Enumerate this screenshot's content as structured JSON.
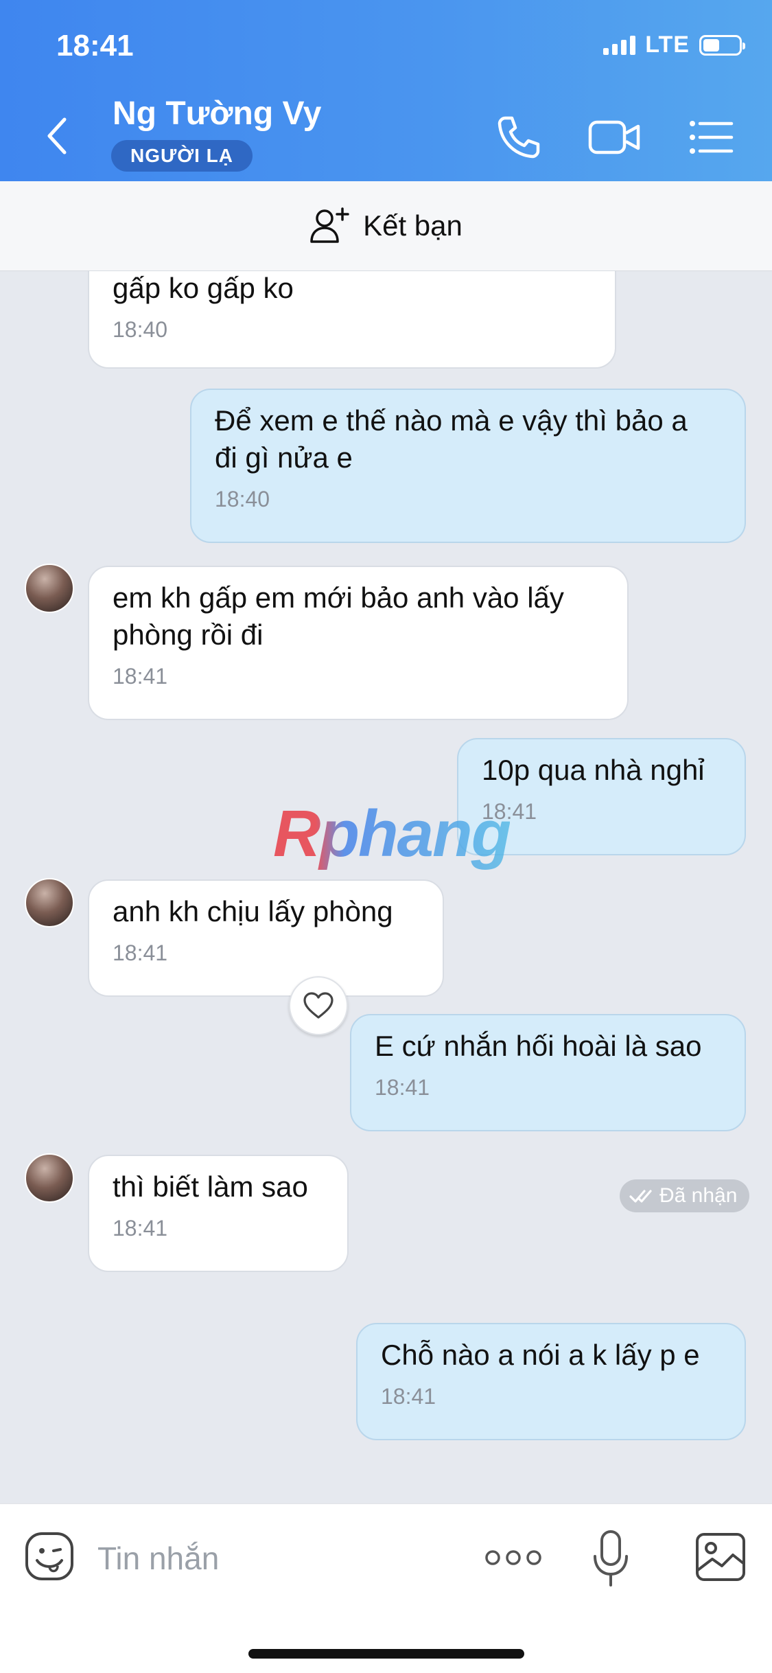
{
  "status_bar": {
    "time": "18:41",
    "network": "LTE",
    "battery_fraction": 0.45
  },
  "header": {
    "contact_name": "Ng Tường Vy",
    "badge": "NGƯỜI LẠ",
    "icons": [
      "chevron-left-icon",
      "phone-icon",
      "video-camera-icon",
      "list-menu-icon"
    ]
  },
  "add_friend": {
    "label": "Kết bạn",
    "icon": "add-user-icon"
  },
  "messages": [
    {
      "from": "them",
      "text": "gấp ko gấp ko",
      "time": "18:40"
    },
    {
      "from": "me",
      "text": "Để xem e thế nào mà e vậy thì bảo a\nđi gì nửa e",
      "time": "18:40"
    },
    {
      "from": "them",
      "text": "em kh gấp em mới bảo anh vào lấy\nphòng rồi đi",
      "time": "18:41"
    },
    {
      "from": "me",
      "text": "10p qua nhà nghỉ",
      "time": "18:41"
    },
    {
      "from": "them",
      "text": "anh kh chịu lấy phòng",
      "time": "18:41"
    },
    {
      "from": "me",
      "text": "E cứ nhắn hối hoài là sao",
      "time": "18:41"
    },
    {
      "from": "them",
      "text": "thì biết làm sao",
      "time": "18:41"
    },
    {
      "from": "me",
      "text": "Chỗ nào a nói a k lấy p e",
      "time": "18:41"
    }
  ],
  "delivery_status": "Đã nhận",
  "watermark": "Rphang",
  "composer": {
    "placeholder": "Tin nhắn",
    "icons": [
      "emoji-icon",
      "more-dots-icon",
      "microphone-icon",
      "image-icon"
    ]
  },
  "colors": {
    "header_start": "#3f86ef",
    "header_end": "#56a7ee",
    "badge_bg": "#2f68c4",
    "outgoing_bubble": "#d5ecfa",
    "incoming_bubble": "#ffffff",
    "chat_background": "#e6e9ef"
  }
}
